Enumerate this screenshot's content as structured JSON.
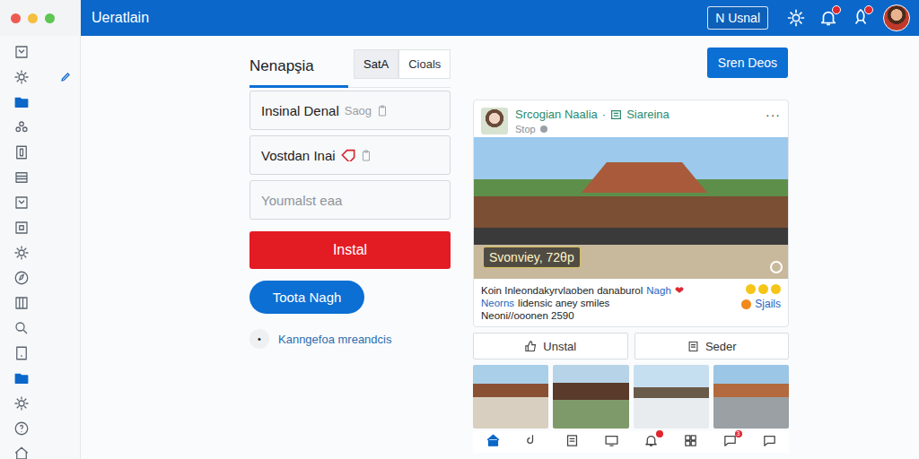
{
  "window": {
    "title": "Ueratlain"
  },
  "topbar": {
    "user_button": "N Usnal",
    "icons": [
      {
        "badge": false
      },
      {
        "badge": true
      },
      {
        "badge": true
      }
    ]
  },
  "sidebar": {
    "items": [
      {
        "selected": false
      },
      {
        "selected": false
      },
      {
        "selected": true
      },
      {
        "selected": false
      },
      {
        "selected": false
      },
      {
        "selected": false
      },
      {
        "selected": false
      },
      {
        "selected": false
      },
      {
        "selected": false
      },
      {
        "selected": false
      },
      {
        "selected": false
      },
      {
        "selected": false
      },
      {
        "selected": false
      },
      {
        "selected": true
      },
      {
        "selected": false
      },
      {
        "selected": false
      },
      {
        "selected": false
      }
    ]
  },
  "form": {
    "title": "Nenapşia",
    "tabs": [
      {
        "label": "SatA",
        "selected": true
      },
      {
        "label": "Cioals",
        "selected": false
      }
    ],
    "fields": [
      {
        "kind": "value",
        "value": "Insinal Denal",
        "hint": "Saog"
      },
      {
        "kind": "tagged",
        "value": "Vostdan Inai"
      },
      {
        "kind": "placeholder",
        "placeholder": "Youmalst eaa"
      }
    ],
    "submit": "Instal",
    "secondary": "Toota Nagh",
    "bullet": "•",
    "link": "Kanngefoa mreandcis"
  },
  "header_button": "Sren Deos",
  "post": {
    "author": "Srcogian Naalia",
    "separator": "·",
    "group": "Siareina",
    "meta": "Stop",
    "more": "···",
    "caption": "Svonviey, 72θp",
    "lines": [
      [
        {
          "text": "Koin Inleondakyrvlaoben danaburol",
          "kind": "plain"
        },
        {
          "text": "Nagh",
          "kind": "link"
        },
        {
          "text": "❤",
          "kind": "heart"
        }
      ],
      [
        {
          "text": "Neorns",
          "kind": "link"
        },
        {
          "text": "lidensic aney smiles",
          "kind": "plain"
        }
      ],
      [
        {
          "text": "Neoni//ooonen 2590",
          "kind": "plain"
        }
      ]
    ],
    "reactions": {
      "label": "Sjails"
    },
    "actions": [
      "Unstal",
      "Seder"
    ]
  },
  "bottom_nav": {
    "items": [
      {
        "selected": true,
        "badge": false
      },
      {
        "selected": false,
        "badge": false
      },
      {
        "selected": false,
        "badge": false
      },
      {
        "selected": false,
        "badge": false
      },
      {
        "selected": false,
        "badge": true
      },
      {
        "selected": false,
        "badge": false
      },
      {
        "selected": false,
        "badge": true,
        "count": "3"
      },
      {
        "selected": false,
        "badge": false
      }
    ]
  }
}
